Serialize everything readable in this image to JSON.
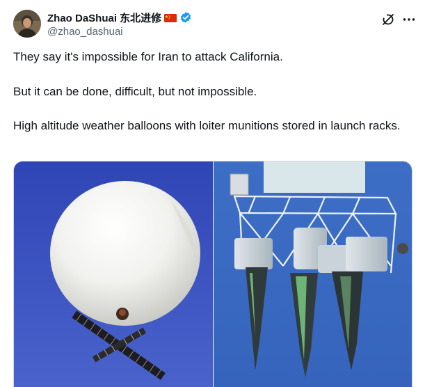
{
  "author": {
    "display_name": "Zhao DaShuai 东北进修",
    "handle": "@zhao_dashuai",
    "flag_icon": "china-flag-icon",
    "verified_icon": "verified-badge-icon",
    "verified_color": "#1d9bf0"
  },
  "actions": {
    "grok_icon": "grok-icon",
    "more_icon": "more-icon"
  },
  "tweet": {
    "paragraphs": [
      "They say it's impossible for Iran to attack California.",
      "But it can be done, difficult, but not impossible.",
      "High altitude weather balloons with loiter munitions stored in launch racks."
    ]
  },
  "media": {
    "photos": [
      {
        "subject": "weather balloon with solar panel array"
      },
      {
        "subject": "launch rack with munitions under balloon"
      }
    ]
  },
  "colors": {
    "text": "#0f1419",
    "secondary": "#536471",
    "border": "#cfd9de"
  }
}
